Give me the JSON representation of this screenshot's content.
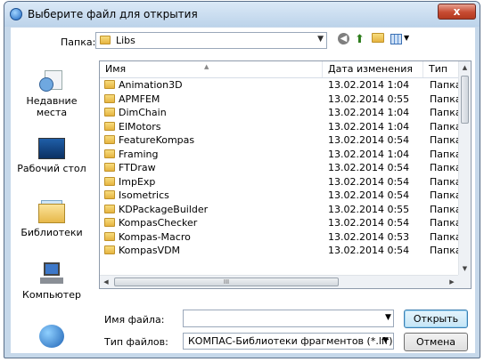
{
  "window": {
    "title": "Выберите файл для открытия",
    "close_label": "x"
  },
  "toolbar": {
    "folder_label": "Папка:",
    "folder_value": "Libs",
    "back_icon": "back-icon",
    "up_icon": "up-folder-icon",
    "new_folder_icon": "new-folder-icon",
    "views_icon": "views-menu-icon"
  },
  "places": [
    {
      "label": "Недавние места",
      "icon": "recent-places-icon"
    },
    {
      "label": "Рабочий стол",
      "icon": "desktop-icon"
    },
    {
      "label": "Библиотеки",
      "icon": "libraries-icon"
    },
    {
      "label": "Компьютер",
      "icon": "computer-icon"
    },
    {
      "label": "",
      "icon": "network-icon"
    }
  ],
  "columns": {
    "name": "Имя",
    "date": "Дата изменения",
    "type": "Тип"
  },
  "files": [
    {
      "name": "Animation3D",
      "date": "13.02.2014 1:04",
      "type": "Папка"
    },
    {
      "name": "APMFEM",
      "date": "13.02.2014 0:55",
      "type": "Папка"
    },
    {
      "name": "DimChain",
      "date": "13.02.2014 1:04",
      "type": "Папка"
    },
    {
      "name": "ElMotors",
      "date": "13.02.2014 1:04",
      "type": "Папка"
    },
    {
      "name": "FeatureKompas",
      "date": "13.02.2014 0:54",
      "type": "Папка"
    },
    {
      "name": "Framing",
      "date": "13.02.2014 1:04",
      "type": "Папка"
    },
    {
      "name": "FTDraw",
      "date": "13.02.2014 0:54",
      "type": "Папка"
    },
    {
      "name": "ImpExp",
      "date": "13.02.2014 0:54",
      "type": "Папка"
    },
    {
      "name": "Isometrics",
      "date": "13.02.2014 0:54",
      "type": "Папка"
    },
    {
      "name": "KDPackageBuilder",
      "date": "13.02.2014 0:55",
      "type": "Папка"
    },
    {
      "name": "KompasChecker",
      "date": "13.02.2014 0:54",
      "type": "Папка"
    },
    {
      "name": "Kompas-Macro",
      "date": "13.02.2014 0:53",
      "type": "Папка"
    },
    {
      "name": "KompasVDM",
      "date": "13.02.2014 0:54",
      "type": "Папка"
    }
  ],
  "hscroll_grip": "III",
  "footer": {
    "filename_label": "Имя файла:",
    "filename_value": "",
    "filetype_label": "Тип файлов:",
    "filetype_value": "КОМПАС-Библиотеки фрагментов (*.lfr)",
    "open_label": "Открыть",
    "cancel_label": "Отмена"
  }
}
